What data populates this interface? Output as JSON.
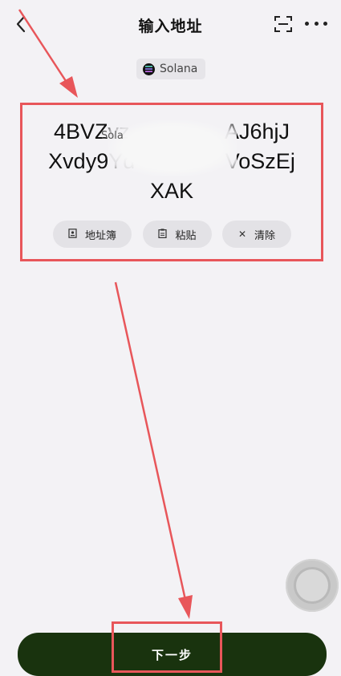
{
  "header": {
    "title": "输入地址",
    "back_icon": "chevron-left-icon",
    "scan_icon": "scan-icon",
    "more_icon": "more-horizontal-icon"
  },
  "network": {
    "name": "Solana",
    "icon": "solana-logo-icon"
  },
  "address": {
    "line1": "4BVZvz                AJ6hjJ",
    "line2": "Xvdy9Yd               VoSzEj",
    "line3": "XAK",
    "overlay_label": "Sola"
  },
  "actions": {
    "address_book": {
      "label": "地址簿",
      "icon": "address-book-icon"
    },
    "paste": {
      "label": "粘贴",
      "icon": "clipboard-icon"
    },
    "clear": {
      "label": "清除",
      "icon": "close-icon"
    }
  },
  "footer": {
    "next_label": "下一步"
  },
  "colors": {
    "annotation_red": "#e8565a",
    "primary_button": "#19330e",
    "background": "#f3f2f5"
  }
}
